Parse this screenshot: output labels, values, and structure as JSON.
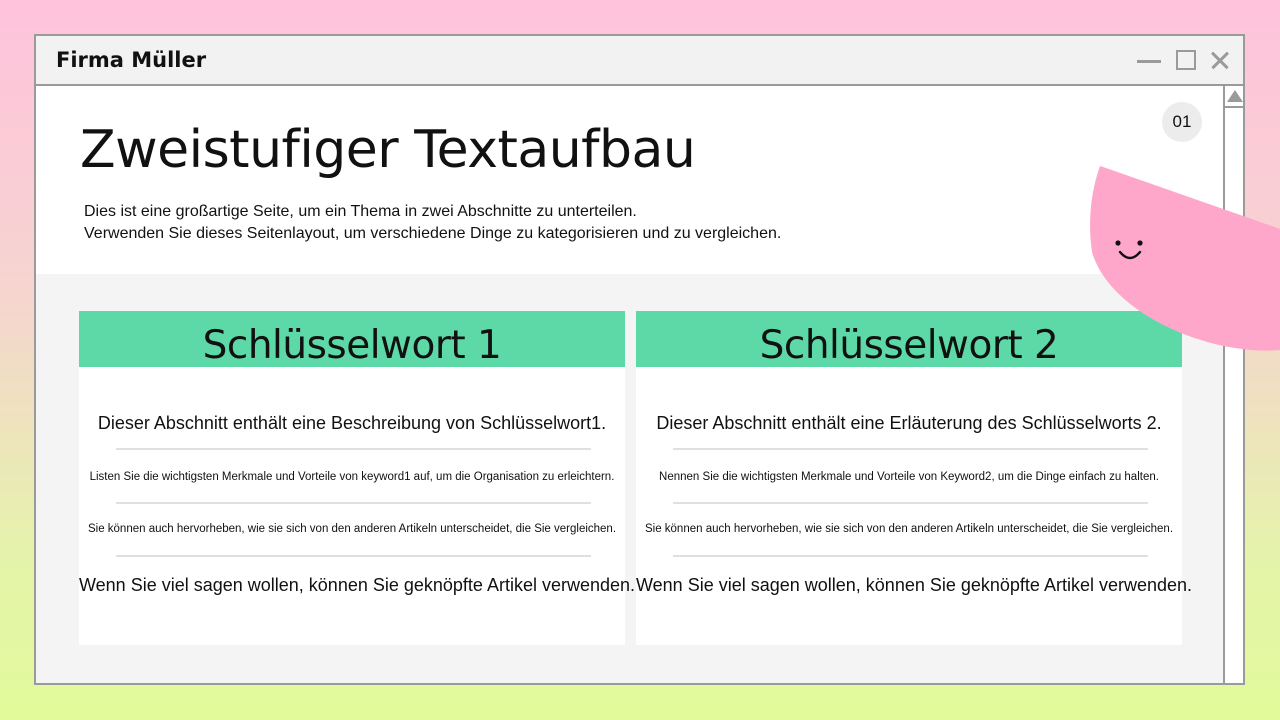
{
  "window": {
    "title": "Firma Müller",
    "controls": [
      "minimize-icon",
      "maximize-icon",
      "close-icon"
    ]
  },
  "page": {
    "number": "01",
    "title": "Zweistufiger Textaufbau",
    "description_line1": "Dies ist eine großartige Seite, um ein Thema in zwei Abschnitte zu unterteilen.",
    "description_line2": "Verwenden Sie dieses Seitenlayout, um verschiedene Dinge zu kategorisieren und zu vergleichen."
  },
  "columns": [
    {
      "heading": "Schlüsselwort 1",
      "lead": "Dieser Abschnitt enthält eine Beschreibung von Schlüsselwort1.",
      "point1": "Listen Sie die wichtigsten Merkmale und Vorteile von keyword1 auf, um die Organisation zu erleichtern.",
      "point2": "Sie können auch hervorheben, wie sie sich von den anderen Artikeln unterscheidet, die Sie vergleichen.",
      "closing": "Wenn Sie viel sagen wollen, können Sie geknöpfte Artikel verwenden."
    },
    {
      "heading": "Schlüsselwort 2",
      "lead": "Dieser Abschnitt enthält eine Erläuterung des Schlüsselworts 2.",
      "point1": "Nennen Sie die wichtigsten Merkmale und Vorteile von Keyword2, um die Dinge einfach zu halten.",
      "point2": "Sie können auch hervorheben, wie sie sich von den anderen Artikeln unterscheidet, die Sie vergleichen.",
      "closing": "Wenn Sie viel sagen wollen, können Sie geknöpfte Artikel verwenden."
    }
  ],
  "colors": {
    "accent_green": "#5dd9a8",
    "mascot_pink": "#ffa6cb",
    "window_border": "#9a9a9a"
  },
  "decoration": "smiley-mascot-icon"
}
